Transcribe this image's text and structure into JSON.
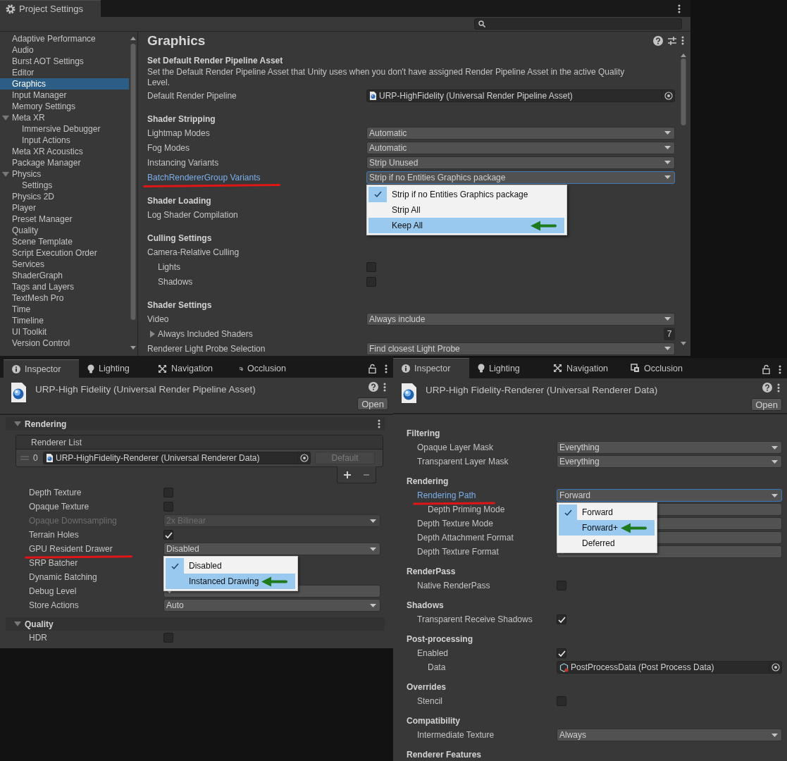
{
  "project_settings": {
    "title": "Project Settings",
    "sidebar": {
      "items": [
        {
          "label": "Adaptive Performance",
          "selected": false
        },
        {
          "label": "Audio",
          "selected": false
        },
        {
          "label": "Burst AOT Settings",
          "selected": false
        },
        {
          "label": "Editor",
          "selected": false
        },
        {
          "label": "Graphics",
          "selected": true
        },
        {
          "label": "Input Manager",
          "selected": false
        },
        {
          "label": "Memory Settings",
          "selected": false
        },
        {
          "label": "Meta XR",
          "selected": false,
          "expanded": true,
          "children": [
            {
              "label": "Immersive Debugger",
              "selected": false
            },
            {
              "label": "Input Actions",
              "selected": false
            }
          ]
        },
        {
          "label": "Meta XR Acoustics",
          "selected": false
        },
        {
          "label": "Package Manager",
          "selected": false
        },
        {
          "label": "Physics",
          "selected": false,
          "expanded": true,
          "children": [
            {
              "label": "Settings",
              "selected": false
            }
          ]
        },
        {
          "label": "Physics 2D",
          "selected": false
        },
        {
          "label": "Player",
          "selected": false
        },
        {
          "label": "Preset Manager",
          "selected": false
        },
        {
          "label": "Quality",
          "selected": false
        },
        {
          "label": "Scene Template",
          "selected": false
        },
        {
          "label": "Script Execution Order",
          "selected": false
        },
        {
          "label": "Services",
          "selected": false
        },
        {
          "label": "ShaderGraph",
          "selected": false
        },
        {
          "label": "Tags and Layers",
          "selected": false
        },
        {
          "label": "TextMesh Pro",
          "selected": false
        },
        {
          "label": "Time",
          "selected": false
        },
        {
          "label": "Timeline",
          "selected": false
        },
        {
          "label": "UI Toolkit",
          "selected": false
        },
        {
          "label": "Version Control",
          "selected": false
        }
      ]
    },
    "page": {
      "title": "Graphics",
      "sections": [
        {
          "title": "Set Default Render Pipeline Asset",
          "description": "Set the Default Render Pipeline Asset that Unity uses when you don't have assigned Render Pipeline Asset in the active Quality Level.",
          "rows": [
            {
              "kind": "object",
              "label": "Default Render Pipeline",
              "value": "URP-HighFidelity (Universal Render Pipeline Asset)"
            }
          ]
        },
        {
          "title": "Shader Stripping",
          "rows": [
            {
              "kind": "dropdown",
              "label": "Lightmap Modes",
              "value": "Automatic"
            },
            {
              "kind": "dropdown",
              "label": "Fog Modes",
              "value": "Automatic"
            },
            {
              "kind": "dropdown",
              "label": "Instancing Variants",
              "value": "Strip Unused"
            },
            {
              "kind": "dropdown",
              "label": "BatchRendererGroup Variants",
              "value": "Strip if no Entities Graphics package",
              "focused": true,
              "underlined": true,
              "menu": {
                "items": [
                  {
                    "label": "Strip if no Entities Graphics package",
                    "checked": true,
                    "highlighted": false
                  },
                  {
                    "label": "Strip All",
                    "checked": false,
                    "highlighted": false
                  },
                  {
                    "label": "Keep All",
                    "checked": false,
                    "highlighted": true,
                    "arrow": true
                  }
                ]
              }
            }
          ]
        },
        {
          "title": "Shader Loading",
          "rows": [
            {
              "kind": "label",
              "label": "Log Shader Compilation"
            }
          ]
        },
        {
          "title": "Culling Settings",
          "rows": [
            {
              "kind": "label",
              "label": "Camera-Relative Culling",
              "children": [
                {
                  "kind": "checkbox",
                  "label": "Lights",
                  "checked": false
                },
                {
                  "kind": "checkbox",
                  "label": "Shadows",
                  "checked": false
                }
              ]
            }
          ]
        },
        {
          "title": "Shader Settings",
          "rows": [
            {
              "kind": "dropdown",
              "label": "Video",
              "value": "Always include"
            },
            {
              "kind": "foldout",
              "label": "Always Included Shaders",
              "expanded": false,
              "count": "7"
            },
            {
              "kind": "dropdown",
              "label": "Renderer Light Probe Selection",
              "value": "Find closest Light Probe"
            }
          ]
        }
      ]
    }
  },
  "inspectors": [
    {
      "tabs": [
        {
          "label": "Inspector",
          "selected": true
        },
        {
          "label": "Lighting",
          "selected": false
        },
        {
          "label": "Navigation",
          "selected": false
        },
        {
          "label": "Occlusion",
          "selected": false
        }
      ],
      "title": "URP-High Fidelity (Universal Render Pipeline Asset)",
      "open_button": "Open",
      "sections": [
        {
          "title": "Rendering",
          "expanded": true,
          "rows": [
            {
              "kind": "list",
              "title": "Renderer List",
              "items": [
                {
                  "index": "0",
                  "value": "URP-HighFidelity-Renderer (Universal Renderer Data)",
                  "button": "Default",
                  "button_disabled": true
                }
              ]
            },
            {
              "kind": "checkbox",
              "label": "Depth Texture",
              "checked": false
            },
            {
              "kind": "checkbox",
              "label": "Opaque Texture",
              "checked": false
            },
            {
              "kind": "dropdown",
              "label": "Opaque Downsampling",
              "value": "2x Bilinear",
              "disabled": true
            },
            {
              "kind": "checkbox",
              "label": "Terrain Holes",
              "checked": true
            },
            {
              "kind": "dropdown",
              "label": "GPU Resident Drawer",
              "value": "Disabled",
              "underlined": true,
              "menu": {
                "items": [
                  {
                    "label": "Disabled",
                    "checked": true,
                    "highlighted": false
                  },
                  {
                    "label": "Instanced Drawing",
                    "checked": false,
                    "highlighted": true,
                    "arrow": true
                  }
                ]
              }
            },
            {
              "kind": "label",
              "label": "SRP Batcher"
            },
            {
              "kind": "label",
              "label": "Dynamic Batching"
            },
            {
              "kind": "dropdown",
              "label": "Debug Level"
            },
            {
              "kind": "dropdown",
              "label": "Store Actions",
              "value": "Auto"
            }
          ]
        },
        {
          "title": "Quality",
          "expanded": true,
          "rows": [
            {
              "kind": "checkbox",
              "label": "HDR",
              "checked": false
            }
          ]
        }
      ]
    },
    {
      "tabs": [
        {
          "label": "Inspector",
          "selected": true
        },
        {
          "label": "Lighting",
          "selected": false
        },
        {
          "label": "Navigation",
          "selected": false
        },
        {
          "label": "Occlusion",
          "selected": false
        }
      ],
      "title": "URP-High Fidelity-Renderer (Universal Renderer Data)",
      "open_button": "Open",
      "sections": [
        {
          "title": "Filtering",
          "rows": [
            {
              "kind": "dropdown",
              "label": "Opaque Layer Mask",
              "value": "Everything"
            },
            {
              "kind": "dropdown",
              "label": "Transparent Layer Mask",
              "value": "Everything"
            }
          ]
        },
        {
          "title": "Rendering",
          "rows": [
            {
              "kind": "dropdown",
              "label": "Rendering Path",
              "value": "Forward",
              "focused": true,
              "underlined": true,
              "menu": {
                "items": [
                  {
                    "label": "Forward",
                    "checked": true,
                    "highlighted": false
                  },
                  {
                    "label": "Forward+",
                    "checked": false,
                    "highlighted": true,
                    "arrow": true
                  },
                  {
                    "label": "Deferred",
                    "checked": false,
                    "highlighted": false
                  }
                ]
              },
              "children": [
                {
                  "kind": "dropdown",
                  "label": "Depth Priming Mode"
                }
              ]
            },
            {
              "kind": "dropdown",
              "label": "Depth Texture Mode"
            },
            {
              "kind": "dropdown",
              "label": "Depth Attachment Format"
            },
            {
              "kind": "dropdown",
              "label": "Depth Texture Format"
            }
          ]
        },
        {
          "title": "RenderPass",
          "rows": [
            {
              "kind": "checkbox",
              "label": "Native RenderPass",
              "checked": false
            }
          ]
        },
        {
          "title": "Shadows",
          "rows": [
            {
              "kind": "checkbox",
              "label": "Transparent Receive Shadows",
              "checked": true
            }
          ]
        },
        {
          "title": "Post-processing",
          "rows": [
            {
              "kind": "checkbox",
              "label": "Enabled",
              "checked": true,
              "children": [
                {
                  "kind": "object",
                  "label": "Data",
                  "value": "PostProcessData (Post Process Data)"
                }
              ]
            }
          ]
        },
        {
          "title": "Overrides",
          "rows": [
            {
              "kind": "checkbox",
              "label": "Stencil",
              "checked": false
            }
          ]
        },
        {
          "title": "Compatibility",
          "rows": [
            {
              "kind": "dropdown",
              "label": "Intermediate Texture",
              "value": "Always"
            }
          ]
        },
        {
          "title": "Renderer Features"
        }
      ]
    }
  ]
}
